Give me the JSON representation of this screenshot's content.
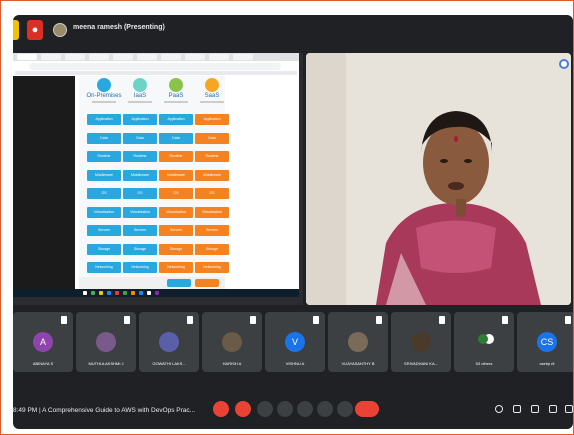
{
  "meeting": {
    "presenter_title": "meena ramesh (Presenting)",
    "bottom": {
      "time_title": "8:49 PM  |  A Comprehensive Guide to AWS with DevOps Prac..."
    }
  },
  "deployment_board": {
    "columns": [
      {
        "heading": "On-Premises",
        "icon_color": "#29a8e0",
        "kind": "blue"
      },
      {
        "heading": "IaaS",
        "icon_color": "#6dd3c9",
        "kind": "blue"
      },
      {
        "heading": "PaaS",
        "icon_color": "#8bc34a",
        "kind": "mixed"
      },
      {
        "heading": "SaaS",
        "icon_color": "#f5a623",
        "kind": "orange"
      }
    ],
    "rows": [
      "Application",
      "Data",
      "Runtime",
      "Middleware",
      "OS",
      "Virtualization",
      "Servers",
      "Storage",
      "Networking"
    ]
  },
  "participants": [
    {
      "initials": "A",
      "name": "ABINAYA S",
      "avatar_color": "#8e44ad",
      "type": "letter"
    },
    {
      "initials": "",
      "name": "MUTHULAKSHMI J",
      "avatar_color": "#7a5a8a",
      "type": "photo"
    },
    {
      "initials": "",
      "name": "GOWATHI LAKS...",
      "avatar_color": "#5b5fa8",
      "type": "photo"
    },
    {
      "initials": "",
      "name": "HARISH A",
      "avatar_color": "#6a5a48",
      "type": "photo"
    },
    {
      "initials": "V",
      "name": "VISHNU A",
      "avatar_color": "#1a73e8",
      "type": "letter"
    },
    {
      "initials": "",
      "name": "VIJAYASANTHY B",
      "avatar_color": "#7a6a5a",
      "type": "photo"
    },
    {
      "initials": "",
      "name": "SRIVADHANI KA...",
      "avatar_color": "#4a3a2a",
      "type": "photo"
    },
    {
      "initials": "",
      "name": "53 others",
      "avatar_color": "#2e7d32",
      "type": "others"
    },
    {
      "initials": "CS",
      "name": "csetip rit",
      "avatar_color": "#1a73e8",
      "type": "letter"
    }
  ]
}
